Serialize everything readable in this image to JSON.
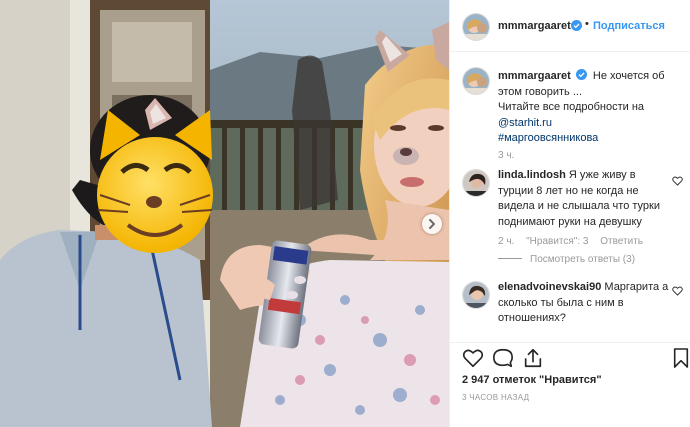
{
  "header": {
    "username": "mmmargaaret",
    "separator": "•",
    "follow_label": "Подписаться"
  },
  "caption": {
    "username": "mmmargaaret",
    "text": "Не хочется об этом говорить ...",
    "line2": "Читайте все подробности на",
    "link": "@starhit.ru",
    "hashtag": "#маргоовсянникова",
    "time": "3 ч."
  },
  "comments": [
    {
      "username": "linda.lindosh",
      "text": "Я уже живу в турции 8 лет но не когда не видела и не слышала что турки поднимают руки на девушку",
      "time": "2 ч.",
      "likes": "\"Нравится\": 3",
      "reply_label": "Ответить",
      "view_replies": "Посмотреть ответы (3)"
    },
    {
      "username": "elenadvoinevskai90",
      "text": "Маргарита а сколько ты была с ним в отношениях?"
    }
  ],
  "actions": {
    "icons": [
      "heart-icon",
      "comment-icon",
      "share-icon",
      "bookmark-icon"
    ]
  },
  "likes_text": "2 947 отметок \"Нравится\"",
  "post_timestamp": "3 ЧАСОВ НАЗАД",
  "colors": {
    "accent": "#3897f0",
    "link": "#003569",
    "muted": "#999999",
    "verified": "#3897f0",
    "border": "#efefef"
  }
}
